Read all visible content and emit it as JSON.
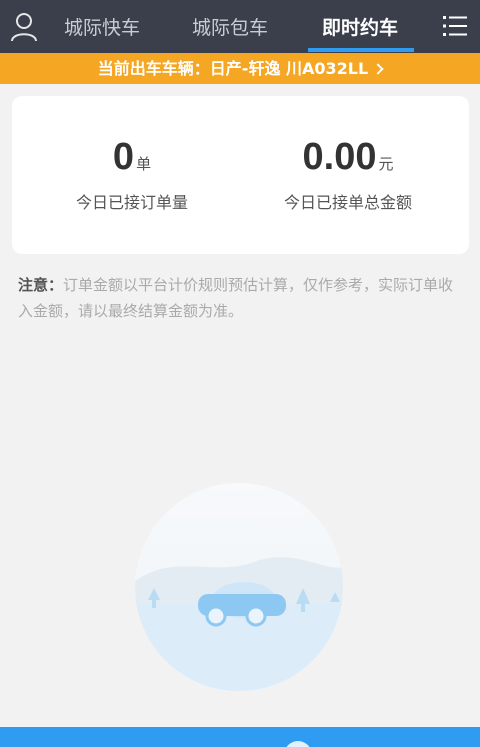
{
  "header": {
    "tabs": [
      {
        "label": "城际快车"
      },
      {
        "label": "城际包车"
      },
      {
        "label": "即时约车"
      }
    ],
    "active_tab_color": "#2f9cf2"
  },
  "banner": {
    "text": "当前出车车辆：日产-轩逸 川A032LL",
    "color": "#f5a623"
  },
  "stats": {
    "orders": {
      "value": "0",
      "unit": "单",
      "label": "今日已接订单量"
    },
    "amount": {
      "value": "0.00",
      "unit": "元",
      "label": "今日已接单总金额"
    }
  },
  "notice": {
    "label": "注意：",
    "text": "订单金额以平台计价规则预估计算，仅作参考，实际订单收入金额，请以最终结算金额为准。"
  },
  "icons": {
    "user": "user-icon",
    "menu": "menu-icon",
    "chevron": "chevron-right-icon"
  }
}
